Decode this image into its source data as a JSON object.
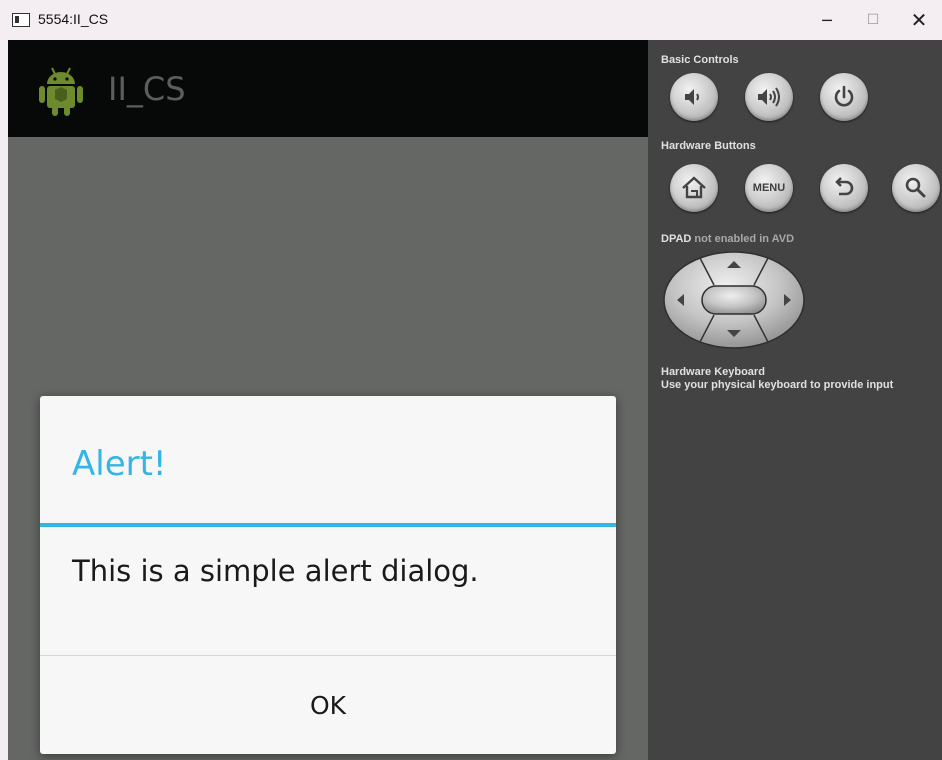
{
  "window": {
    "title": "5554:II_CS",
    "minimize_glyph": "─",
    "maximize_glyph": "☐",
    "close_glyph": "✕"
  },
  "app": {
    "title": "II_CS",
    "icon": "android-robot-icon"
  },
  "dialog": {
    "title": "Alert!",
    "message": "This is a simple alert dialog.",
    "ok_label": "OK"
  },
  "panel": {
    "basic_controls_label": "Basic Controls",
    "hardware_buttons_label": "Hardware Buttons",
    "dpad_label": "DPAD",
    "dpad_note": "not enabled in AVD",
    "keyboard_label": "Hardware Keyboard",
    "keyboard_note": "Use your physical keyboard to provide input",
    "menu_label": "MENU",
    "basic_buttons": [
      "volume-down-icon",
      "volume-up-icon",
      "power-icon"
    ],
    "hardware_buttons": [
      "home-icon",
      "menu-icon",
      "back-icon",
      "search-icon"
    ]
  },
  "colors": {
    "accent": "#33b5e5",
    "action_bar": "#070808",
    "screen_background": "#656765",
    "panel_background": "#434343",
    "dialog_background": "#f7f7f7"
  }
}
